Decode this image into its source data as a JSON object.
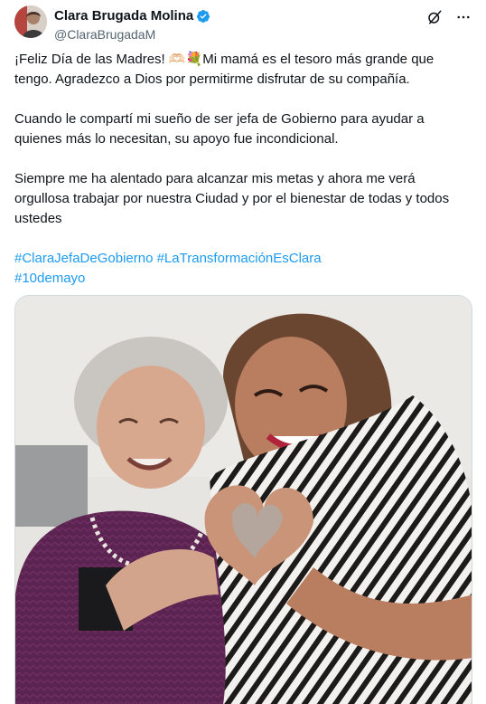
{
  "author": {
    "display_name": "Clara Brugada Molina",
    "handle": "@ClaraBrugadaM",
    "avatar_icon": "profile-photo",
    "verified_icon": "verified-badge-icon"
  },
  "actions": {
    "grok_icon": "grok-icon",
    "more_icon": "more-options-icon"
  },
  "tweet": {
    "para1_a": "¡Feliz Día de las Madres! ",
    "emoji1": "🫶🏻",
    "emoji2": "💐",
    "para1_b": "Mi mamá es el tesoro más grande que tengo. Agradezco a Dios por permitirme disfrutar de su compañía.",
    "para2": "Cuando le compartí mi sueño de ser jefa de Gobierno para ayudar a quienes más lo necesitan, su apoyo fue incondicional.",
    "para3": "Siempre me ha alentado para alcanzar mis metas y ahora me verá orgullosa trabajar por nuestra Ciudad y por el bienestar de todas y todos ustedes",
    "hashtags": [
      "#ClaraJefaDeGobierno",
      "#LaTransformaciónEsClara",
      "#10demayo"
    ]
  },
  "colors": {
    "link": "#1d9bf0",
    "secondary": "#536471",
    "verified": "#1d9bf0"
  }
}
